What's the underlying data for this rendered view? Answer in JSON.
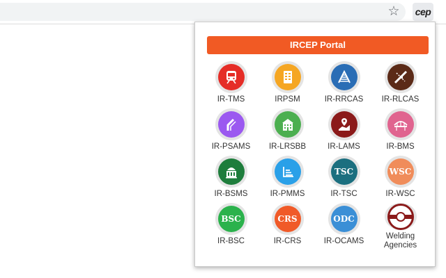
{
  "browser": {
    "bookmark_icon": "star-icon",
    "extension_badge": "cep"
  },
  "popup": {
    "portal_button": "IRCEP Portal",
    "apps": [
      {
        "label": "IR-TMS",
        "icon": "train-icon",
        "color": "#e52d27"
      },
      {
        "label": "IRPSM",
        "icon": "document-icon",
        "color": "#f5a623"
      },
      {
        "label": "IR-RRCAS",
        "icon": "track-icon",
        "color": "#2a6db5"
      },
      {
        "label": "IR-RLCAS",
        "icon": "crossing-icon",
        "color": "#5b2a17"
      },
      {
        "label": "IR-PSAMS",
        "icon": "pipe-icon",
        "color": "#9b59f0"
      },
      {
        "label": "IR-LRSBB",
        "icon": "building-icon",
        "color": "#4caf50"
      },
      {
        "label": "IR-LAMS",
        "icon": "land-map-icon",
        "color": "#8b1a1a"
      },
      {
        "label": "IR-BMS",
        "icon": "bridge-icon",
        "color": "#e0648f"
      },
      {
        "label": "IR-BSMS",
        "icon": "station-icon",
        "color": "#1e7d3c"
      },
      {
        "label": "IR-PMMS",
        "icon": "stairs-icon",
        "color": "#2aa0e8"
      },
      {
        "label": "IR-TSC",
        "icon": "tsc-icon",
        "text": "TSC",
        "color": "#1b6f7f"
      },
      {
        "label": "IR-WSC",
        "icon": "wsc-icon",
        "text": "WSC",
        "color": "#f08c5a"
      },
      {
        "label": "IR-BSC",
        "icon": "bsc-icon",
        "text": "BSC",
        "color": "#2bb24c"
      },
      {
        "label": "IR-CRS",
        "icon": "crs-icon",
        "text": "CRS",
        "color": "#f05a28"
      },
      {
        "label": "IR-OCAMS",
        "icon": "odc-icon",
        "text": "ODC",
        "color": "#3b8fd6"
      },
      {
        "label": "Welding\nAgencies",
        "icon": "rail-section-icon",
        "color": "#8b1a1a"
      }
    ]
  }
}
